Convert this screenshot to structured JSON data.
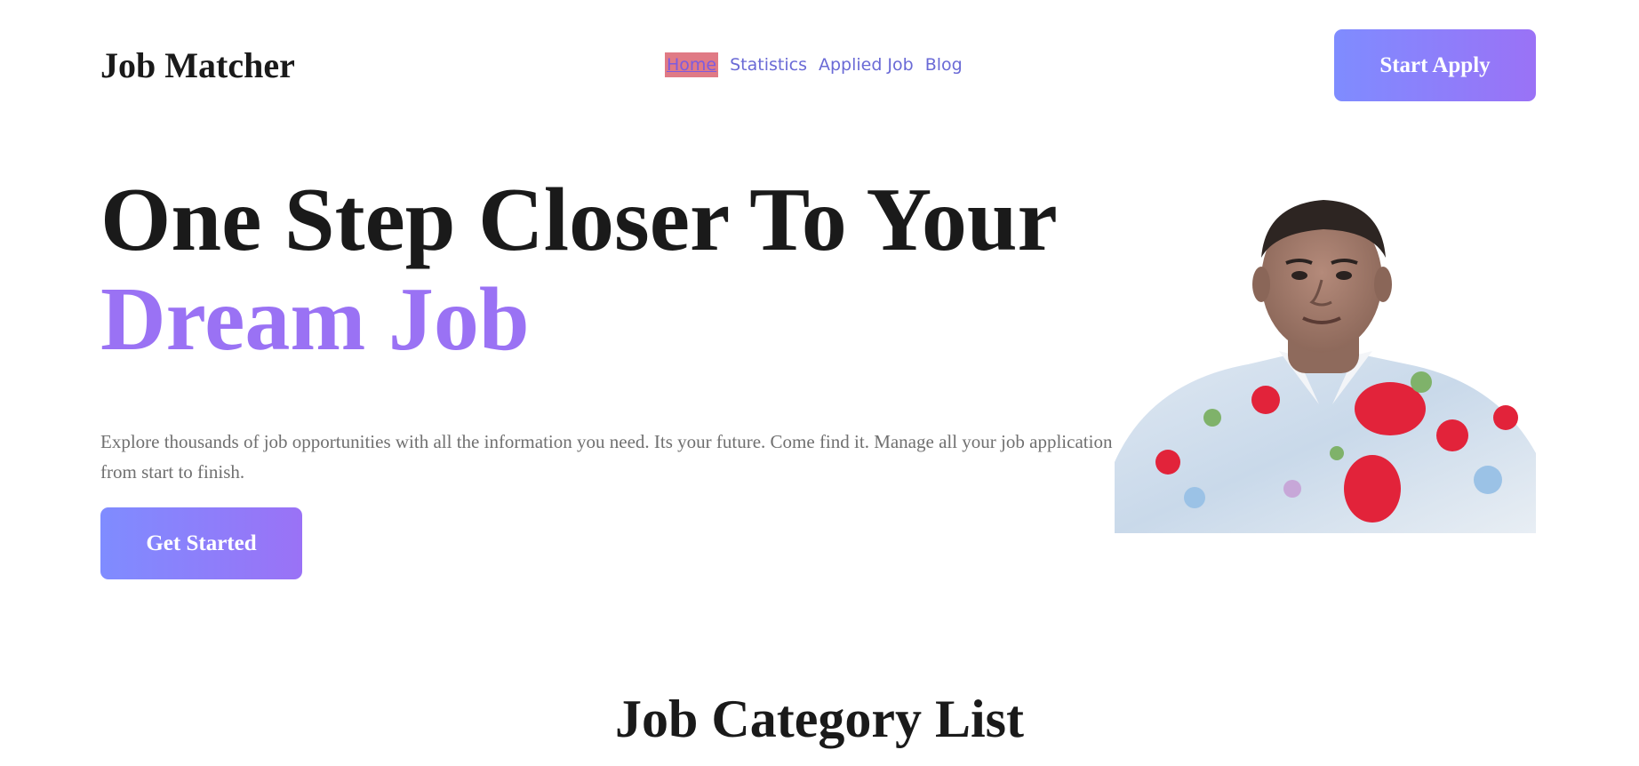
{
  "header": {
    "brand": "Job Matcher",
    "nav": [
      {
        "label": "Home",
        "active": true
      },
      {
        "label": "Statistics",
        "active": false
      },
      {
        "label": "Applied Job",
        "active": false
      },
      {
        "label": "Blog",
        "active": false
      }
    ],
    "cta_label": "Start Apply"
  },
  "hero": {
    "title_line1": "One Step Closer To Your",
    "title_line2": "Dream Job",
    "description": "Explore thousands of job opportunities with all the information you need. Its your future. Come find it. Manage all your job application from start to finish.",
    "button_label": "Get Started",
    "image": "person-portrait-photo"
  },
  "section": {
    "title": "Job Category List"
  },
  "colors": {
    "accent_gradient_start": "#7f8cff",
    "accent_gradient_end": "#9a72f6",
    "nav_link": "#6a6ad6",
    "nav_active_bg": "#e07a85",
    "hero_highlight": "#9a72f4"
  }
}
